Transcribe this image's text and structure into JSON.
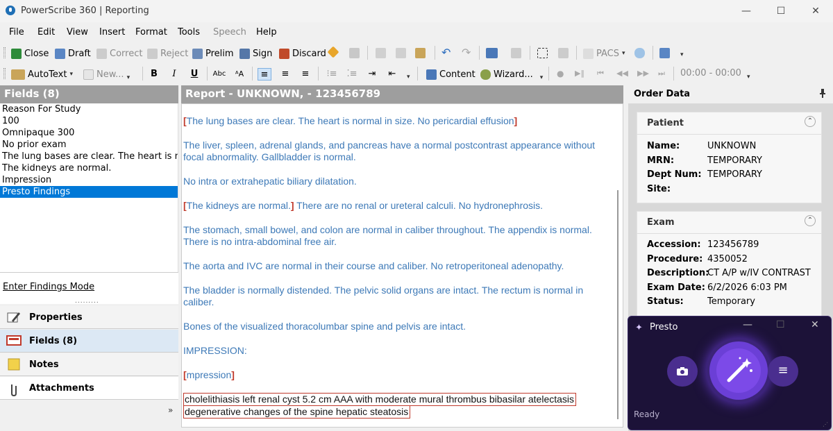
{
  "window": {
    "title": "PowerScribe 360 | Reporting",
    "minimize": "—",
    "maximize": "☐",
    "close": "✕"
  },
  "menu": [
    "File",
    "Edit",
    "View",
    "Insert",
    "Format",
    "Tools",
    "Speech",
    "Help"
  ],
  "toolbar1": {
    "close": "Close",
    "draft": "Draft",
    "correct": "Correct",
    "reject": "Reject",
    "prelim": "Prelim",
    "sign": "Sign",
    "discard": "Discard",
    "pacs": "PACS"
  },
  "toolbar2": {
    "autotext": "AutoText",
    "new": "New...",
    "bold": "B",
    "italic": "I",
    "underline": "U",
    "content": "Content",
    "wizard": "Wizard...",
    "timer": "00:00 - 00:00"
  },
  "fields": {
    "header": "Fields (8)",
    "items": [
      "Reason For Study",
      "100",
      "Omnipaque 300",
      "No prior exam",
      "The lung bases are clear.  The heart is no",
      "The kidneys are normal.",
      "Impression",
      "Presto Findings"
    ],
    "selected_index": 7,
    "enter_findings_mode": "Enter Findings Mode",
    "splitter": "........."
  },
  "nav_tabs": {
    "properties": "Properties",
    "fields": "Fields (8)",
    "notes": "Notes",
    "attachments": "Attachments",
    "more": "»"
  },
  "report": {
    "header": "Report - UNKNOWN, - 123456789",
    "p1": "The lung bases are clear.  The heart is normal in size. No pericardial effusion",
    "p2": "The liver, spleen, adrenal glands, and pancreas have a normal postcontrast appearance without focal abnormality. Gallbladder is normal.",
    "p3": "No intra or extrahepatic biliary dilatation.",
    "p4a": "The kidneys are normal.",
    "p4b": " There are no renal or ureteral calculi.  No hydronephrosis.",
    "p5": "The stomach, small bowel, and colon are normal in caliber throughout. The appendix is normal. There is no intra-abdominal free air.",
    "p6": "The aorta and IVC are normal in their course and caliber. No retroperitoneal adenopathy.",
    "p7": "The bladder is normally distended. The pelvic solid organs are intact.  The rectum is normal in caliber.",
    "p8": "Bones of the visualized thoracolumbar spine and pelvis are intact.",
    "impression_label": "IMPRESSION:",
    "impression_field": "mpression",
    "findings_line1": "cholelithiasis left renal cyst 5.2 cm AAA with moderate mural thrombus bibasilar atelectasis",
    "findings_line2": "degenerative changes of the spine hepatic steatosis"
  },
  "order": {
    "header": "Order Data",
    "patient": {
      "title": "Patient",
      "name_label": "Name:",
      "name": "UNKNOWN",
      "mrn_label": "MRN:",
      "mrn": "TEMPORARY",
      "dept_label": "Dept Num:",
      "dept": "TEMPORARY",
      "site_label": "Site:",
      "site": ""
    },
    "exam": {
      "title": "Exam",
      "accession_label": "Accession:",
      "accession": "123456789",
      "procedure_label": "Procedure:",
      "procedure": "4350052",
      "description_label": "Description:",
      "description": "CT A/P w/IV CONTRAST",
      "date_label": "Exam Date:",
      "date": "6/2/2026 6:03 PM",
      "status_label": "Status:",
      "status": "Temporary"
    }
  },
  "presto": {
    "title": "Presto",
    "status": "Ready"
  },
  "colors": {
    "report_text": "#3d79b7",
    "field_bracket": "#c0392b",
    "selection": "#0078d7",
    "presto_bg": "#1c1238",
    "presto_accent": "#7c4ae8"
  },
  "icons": [
    "microphone-icon",
    "camera-icon",
    "magic-wand-icon",
    "hamburger-icon",
    "pin-icon",
    "chevron-up-icon"
  ]
}
